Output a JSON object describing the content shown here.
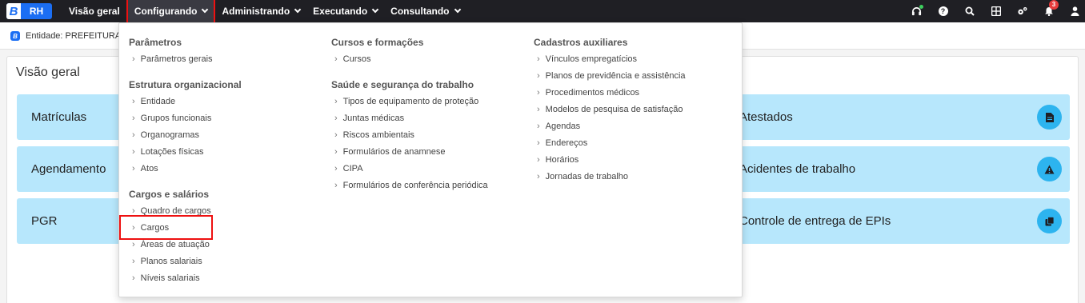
{
  "brand": {
    "letter": "B",
    "product": "RH"
  },
  "nav": {
    "items": [
      {
        "label": "Visão geral"
      },
      {
        "label": "Configurando"
      },
      {
        "label": "Administrando"
      },
      {
        "label": "Executando"
      },
      {
        "label": "Consultando"
      }
    ]
  },
  "notifications": {
    "count": "3"
  },
  "entity": {
    "text": "Entidade: PREFEITURA D"
  },
  "main": {
    "title": "Visão geral",
    "tiles": [
      {
        "label": "Matrículas"
      },
      {
        "label": "Agendamento"
      },
      {
        "label": "PGR"
      },
      {
        "label": "Atestados",
        "icon": "file-icon"
      },
      {
        "label": "Acidentes de trabalho",
        "icon": "warning-icon"
      },
      {
        "label": "Controle de entrega de EPIs",
        "icon": "copy-icon"
      }
    ]
  },
  "menu": {
    "col1": {
      "parametros": {
        "title": "Parâmetros",
        "items": [
          "Parâmetros gerais"
        ]
      },
      "estrutura": {
        "title": "Estrutura organizacional",
        "items": [
          "Entidade",
          "Grupos funcionais",
          "Organogramas",
          "Lotações físicas",
          "Atos"
        ]
      },
      "cargos": {
        "title": "Cargos e salários",
        "items": [
          "Quadro de cargos",
          "Cargos",
          "Áreas de atuação",
          "Planos salariais",
          "Níveis salariais"
        ]
      }
    },
    "col2": {
      "cursos": {
        "title": "Cursos e formações",
        "items": [
          "Cursos"
        ]
      },
      "saude": {
        "title": "Saúde e segurança do trabalho",
        "items": [
          "Tipos de equipamento de proteção",
          "Juntas médicas",
          "Riscos ambientais",
          "Formulários de anamnese",
          "CIPA",
          "Formulários de conferência periódica"
        ]
      }
    },
    "col3": {
      "cadastros": {
        "title": "Cadastros auxiliares",
        "items": [
          "Vínculos empregatícios",
          "Planos de previdência e assistência",
          "Procedimentos médicos",
          "Modelos de pesquisa de satisfação",
          "Agendas",
          "Endereços",
          "Horários",
          "Jornadas de trabalho"
        ]
      }
    }
  }
}
